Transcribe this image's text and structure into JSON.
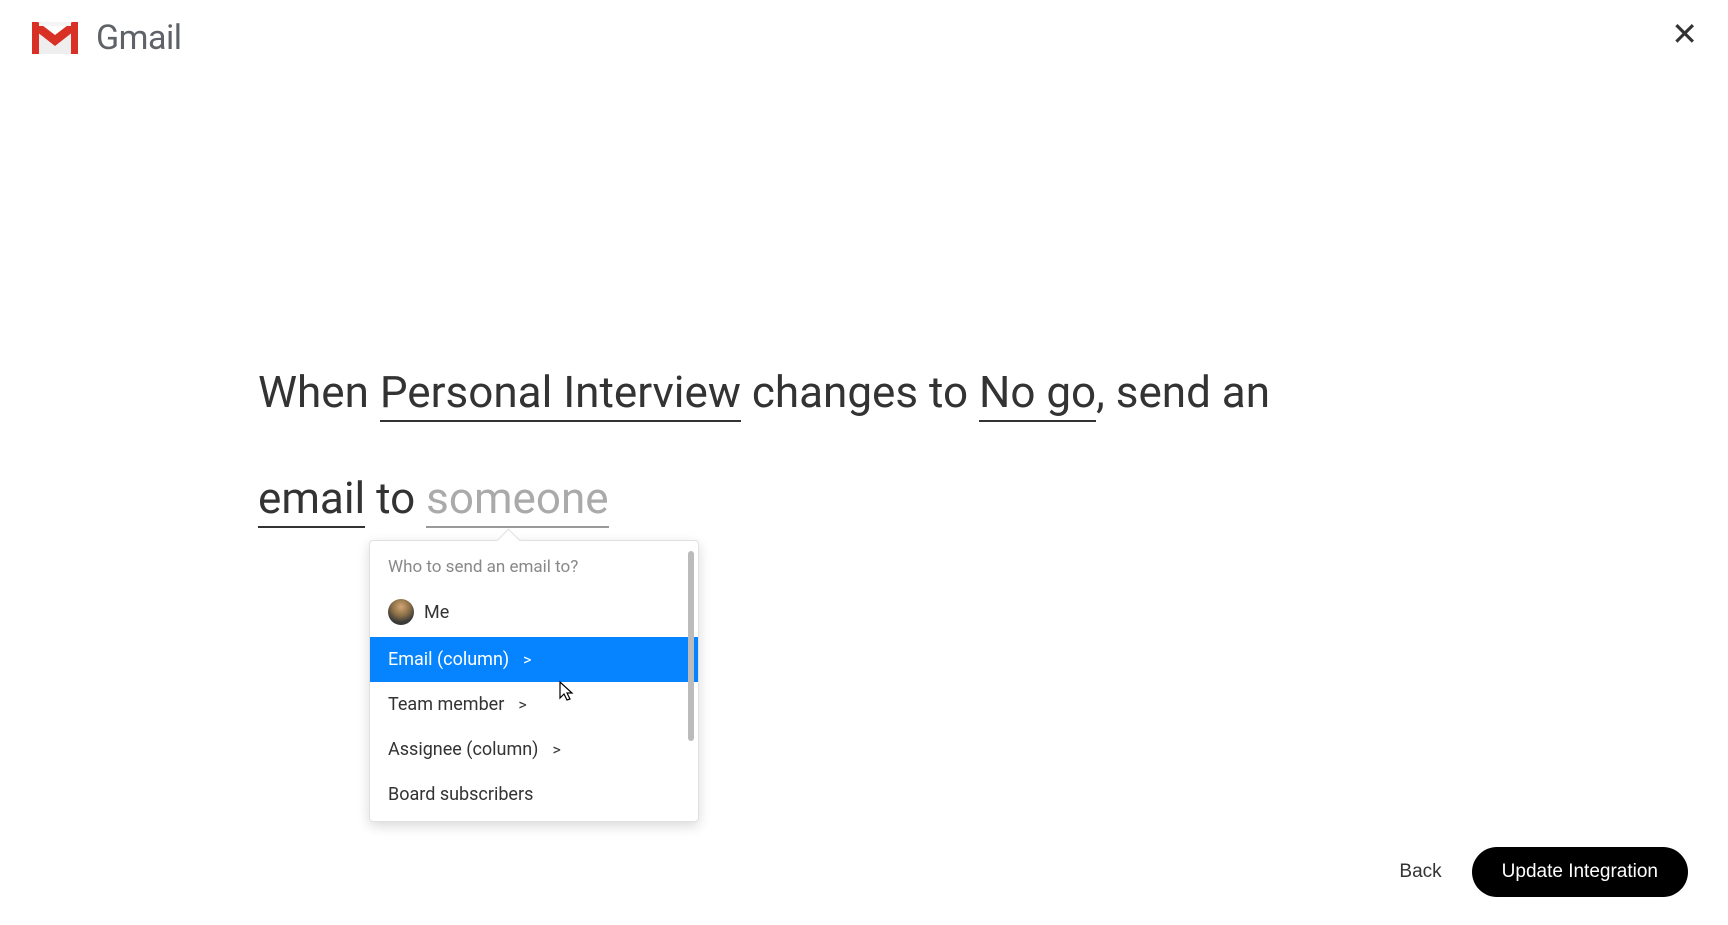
{
  "header": {
    "app_name": "Gmail"
  },
  "sentence": {
    "prefix1": "When ",
    "column_value": "Personal Interview",
    "middle1": " changes to ",
    "status_value": "No go",
    "middle2": ", send an ",
    "action_value": "email",
    "middle3": " to ",
    "recipient_placeholder": "someone"
  },
  "dropdown": {
    "title": "Who to send an email to?",
    "items": [
      {
        "label": "Me",
        "has_avatar": true,
        "has_chevron": false,
        "selected": false
      },
      {
        "label": "Email (column)",
        "has_avatar": false,
        "has_chevron": true,
        "selected": true
      },
      {
        "label": "Team member",
        "has_avatar": false,
        "has_chevron": true,
        "selected": false
      },
      {
        "label": "Assignee (column)",
        "has_avatar": false,
        "has_chevron": true,
        "selected": false
      },
      {
        "label": "Board subscribers",
        "has_avatar": false,
        "has_chevron": false,
        "selected": false
      }
    ]
  },
  "footer": {
    "back_label": "Back",
    "update_label": "Update Integration"
  }
}
